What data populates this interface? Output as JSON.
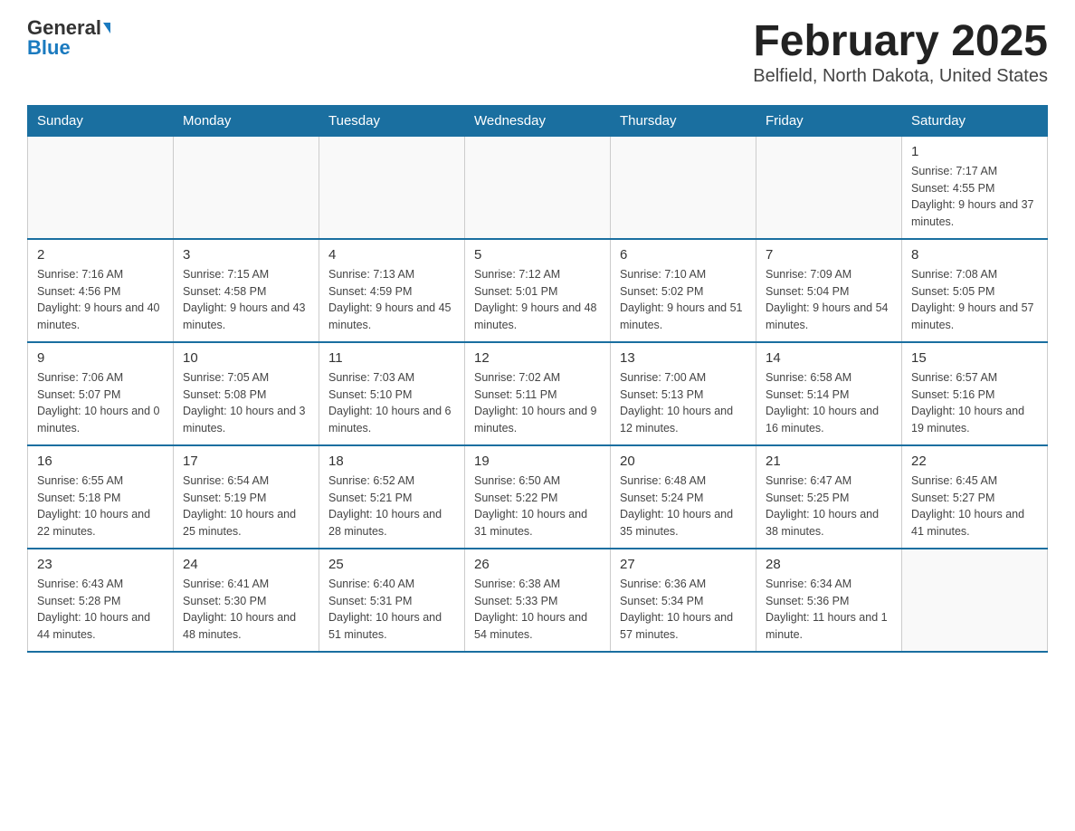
{
  "logo": {
    "general": "General",
    "blue": "Blue"
  },
  "title": "February 2025",
  "subtitle": "Belfield, North Dakota, United States",
  "days_of_week": [
    "Sunday",
    "Monday",
    "Tuesday",
    "Wednesday",
    "Thursday",
    "Friday",
    "Saturday"
  ],
  "weeks": [
    [
      {
        "day": "",
        "info": ""
      },
      {
        "day": "",
        "info": ""
      },
      {
        "day": "",
        "info": ""
      },
      {
        "day": "",
        "info": ""
      },
      {
        "day": "",
        "info": ""
      },
      {
        "day": "",
        "info": ""
      },
      {
        "day": "1",
        "info": "Sunrise: 7:17 AM\nSunset: 4:55 PM\nDaylight: 9 hours and 37 minutes."
      }
    ],
    [
      {
        "day": "2",
        "info": "Sunrise: 7:16 AM\nSunset: 4:56 PM\nDaylight: 9 hours and 40 minutes."
      },
      {
        "day": "3",
        "info": "Sunrise: 7:15 AM\nSunset: 4:58 PM\nDaylight: 9 hours and 43 minutes."
      },
      {
        "day": "4",
        "info": "Sunrise: 7:13 AM\nSunset: 4:59 PM\nDaylight: 9 hours and 45 minutes."
      },
      {
        "day": "5",
        "info": "Sunrise: 7:12 AM\nSunset: 5:01 PM\nDaylight: 9 hours and 48 minutes."
      },
      {
        "day": "6",
        "info": "Sunrise: 7:10 AM\nSunset: 5:02 PM\nDaylight: 9 hours and 51 minutes."
      },
      {
        "day": "7",
        "info": "Sunrise: 7:09 AM\nSunset: 5:04 PM\nDaylight: 9 hours and 54 minutes."
      },
      {
        "day": "8",
        "info": "Sunrise: 7:08 AM\nSunset: 5:05 PM\nDaylight: 9 hours and 57 minutes."
      }
    ],
    [
      {
        "day": "9",
        "info": "Sunrise: 7:06 AM\nSunset: 5:07 PM\nDaylight: 10 hours and 0 minutes."
      },
      {
        "day": "10",
        "info": "Sunrise: 7:05 AM\nSunset: 5:08 PM\nDaylight: 10 hours and 3 minutes."
      },
      {
        "day": "11",
        "info": "Sunrise: 7:03 AM\nSunset: 5:10 PM\nDaylight: 10 hours and 6 minutes."
      },
      {
        "day": "12",
        "info": "Sunrise: 7:02 AM\nSunset: 5:11 PM\nDaylight: 10 hours and 9 minutes."
      },
      {
        "day": "13",
        "info": "Sunrise: 7:00 AM\nSunset: 5:13 PM\nDaylight: 10 hours and 12 minutes."
      },
      {
        "day": "14",
        "info": "Sunrise: 6:58 AM\nSunset: 5:14 PM\nDaylight: 10 hours and 16 minutes."
      },
      {
        "day": "15",
        "info": "Sunrise: 6:57 AM\nSunset: 5:16 PM\nDaylight: 10 hours and 19 minutes."
      }
    ],
    [
      {
        "day": "16",
        "info": "Sunrise: 6:55 AM\nSunset: 5:18 PM\nDaylight: 10 hours and 22 minutes."
      },
      {
        "day": "17",
        "info": "Sunrise: 6:54 AM\nSunset: 5:19 PM\nDaylight: 10 hours and 25 minutes."
      },
      {
        "day": "18",
        "info": "Sunrise: 6:52 AM\nSunset: 5:21 PM\nDaylight: 10 hours and 28 minutes."
      },
      {
        "day": "19",
        "info": "Sunrise: 6:50 AM\nSunset: 5:22 PM\nDaylight: 10 hours and 31 minutes."
      },
      {
        "day": "20",
        "info": "Sunrise: 6:48 AM\nSunset: 5:24 PM\nDaylight: 10 hours and 35 minutes."
      },
      {
        "day": "21",
        "info": "Sunrise: 6:47 AM\nSunset: 5:25 PM\nDaylight: 10 hours and 38 minutes."
      },
      {
        "day": "22",
        "info": "Sunrise: 6:45 AM\nSunset: 5:27 PM\nDaylight: 10 hours and 41 minutes."
      }
    ],
    [
      {
        "day": "23",
        "info": "Sunrise: 6:43 AM\nSunset: 5:28 PM\nDaylight: 10 hours and 44 minutes."
      },
      {
        "day": "24",
        "info": "Sunrise: 6:41 AM\nSunset: 5:30 PM\nDaylight: 10 hours and 48 minutes."
      },
      {
        "day": "25",
        "info": "Sunrise: 6:40 AM\nSunset: 5:31 PM\nDaylight: 10 hours and 51 minutes."
      },
      {
        "day": "26",
        "info": "Sunrise: 6:38 AM\nSunset: 5:33 PM\nDaylight: 10 hours and 54 minutes."
      },
      {
        "day": "27",
        "info": "Sunrise: 6:36 AM\nSunset: 5:34 PM\nDaylight: 10 hours and 57 minutes."
      },
      {
        "day": "28",
        "info": "Sunrise: 6:34 AM\nSunset: 5:36 PM\nDaylight: 11 hours and 1 minute."
      },
      {
        "day": "",
        "info": ""
      }
    ]
  ]
}
